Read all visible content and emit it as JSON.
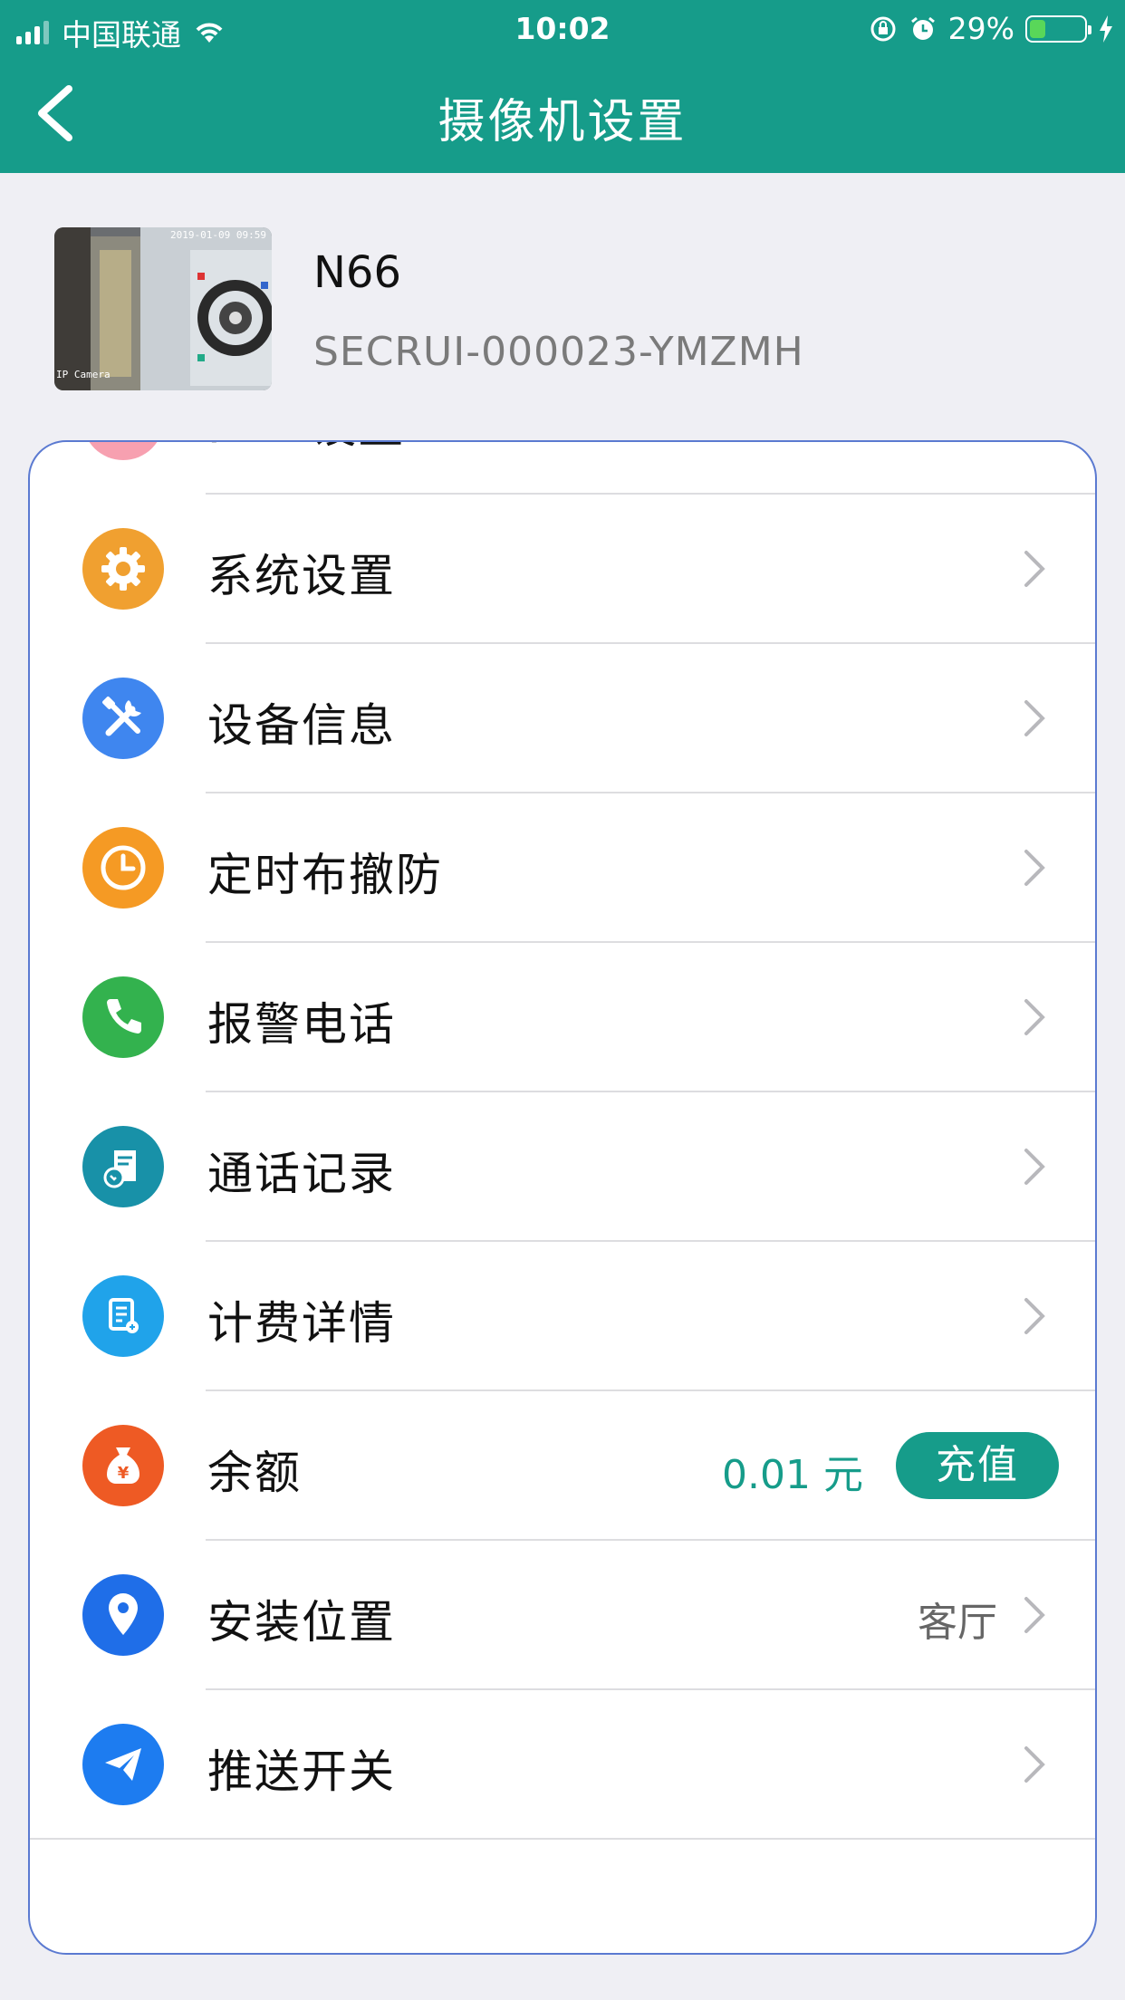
{
  "status_bar": {
    "carrier": "中国联通",
    "time": "10:02",
    "battery": "29%",
    "battery_level": 0.29
  },
  "header": {
    "title": "摄像机设置"
  },
  "device": {
    "name": "N66",
    "id": "SECRUI-000023-YMZMH",
    "thumb_timestamp": "2019-01-09 09:59",
    "thumb_caption": "IP Camera"
  },
  "menu": [
    {
      "label": "PTT 设置",
      "icon": "ptt-icon",
      "color": "#f7a0b0"
    },
    {
      "label": "系统设置",
      "icon": "gear-icon",
      "color": "#f0a030"
    },
    {
      "label": "设备信息",
      "icon": "tools-icon",
      "color": "#3f86ef"
    },
    {
      "label": "定时布撤防",
      "icon": "clock-icon",
      "color": "#f59a24"
    },
    {
      "label": "报警电话",
      "icon": "phone-icon",
      "color": "#33b24e"
    },
    {
      "label": "通话记录",
      "icon": "call-log-icon",
      "color": "#1891a8"
    },
    {
      "label": "计费详情",
      "icon": "bill-icon",
      "color": "#20a3ea"
    },
    {
      "label": "余额",
      "icon": "money-bag-icon",
      "color": "#ee5a24",
      "value": "0.01 元",
      "action": "充值"
    },
    {
      "label": "安装位置",
      "icon": "location-pin-icon",
      "color": "#1f6ee8",
      "value": "客厅"
    },
    {
      "label": "推送开关",
      "icon": "send-icon",
      "color": "#1d7cf0"
    }
  ],
  "colors": {
    "primary": "#169c8a",
    "page_background": "#efeff4"
  }
}
